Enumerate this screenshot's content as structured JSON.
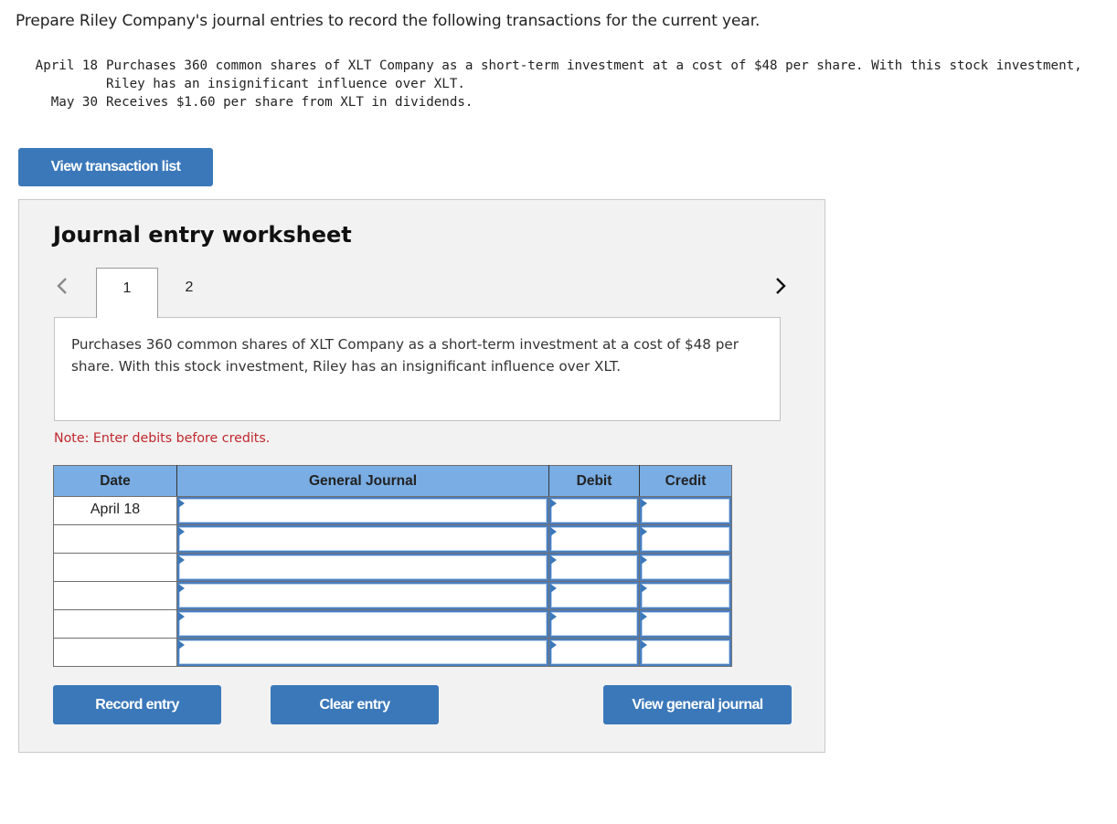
{
  "intro": "Prepare Riley Company's journal entries to record the following transactions for the current year.",
  "transactions": [
    {
      "date": "April 18",
      "description": "Purchases 360 common shares of XLT Company as a short-term investment at a cost of $48 per share. With this stock investment, Riley has an insignificant influence over XLT."
    },
    {
      "date": "May 30",
      "description": "Receives $1.60 per share from XLT in dividends."
    }
  ],
  "buttons": {
    "view_transaction_list": "View transaction list",
    "record_entry": "Record entry",
    "clear_entry": "Clear entry",
    "view_general_journal": "View general journal"
  },
  "worksheet": {
    "title": "Journal entry worksheet",
    "tabs": [
      {
        "label": "1",
        "active": true
      },
      {
        "label": "2",
        "active": false
      }
    ],
    "prev_icon": "chevron-left-icon",
    "next_icon": "chevron-right-icon",
    "description": "Purchases 360 common shares of XLT Company as a short-term investment at a cost of $48 per share. With this stock investment, Riley has an insignificant influence over XLT.",
    "note": "Note: Enter debits before credits."
  },
  "journal": {
    "columns": [
      "Date",
      "General Journal",
      "Debit",
      "Credit"
    ],
    "rows": [
      {
        "date": "April 18",
        "account": "",
        "debit": "",
        "credit": ""
      },
      {
        "date": "",
        "account": "",
        "debit": "",
        "credit": ""
      },
      {
        "date": "",
        "account": "",
        "debit": "",
        "credit": ""
      },
      {
        "date": "",
        "account": "",
        "debit": "",
        "credit": ""
      },
      {
        "date": "",
        "account": "",
        "debit": "",
        "credit": ""
      },
      {
        "date": "",
        "account": "",
        "debit": "",
        "credit": ""
      }
    ]
  },
  "colors": {
    "button_blue": "#3b78b9",
    "header_blue": "#79ade4",
    "note_red": "#c0272d",
    "panel_bg": "#f2f2f2"
  }
}
